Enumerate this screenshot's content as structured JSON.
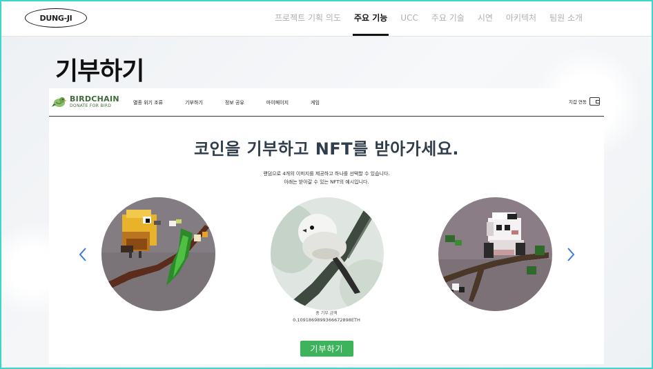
{
  "site": {
    "logo": "DUNG-JI",
    "nav": [
      "프로젝트 기획 의도",
      "주요 기능",
      "UCC",
      "주요 기술",
      "시연",
      "아키텍처",
      "팀원 소개"
    ],
    "active_index": 1
  },
  "page_title": "기부하기",
  "app": {
    "brand_name": "BIRDCHAIN",
    "brand_sub": "DONATE FOR BIRD",
    "nav": [
      "멸종 위기 조류",
      "기부하기",
      "정보 공유",
      "마이페이지",
      "게임"
    ],
    "wallet_label": "지갑 연동",
    "hero_title": "코인을 기부하고 NFT를 받아가세요.",
    "desc_line1": "랜덤으로 4개의 이미지를 제공하고 하나를 선택할 수 있습니다.",
    "desc_line2": "아래는 받아갈 수 있는 NFT의 예시입니다.",
    "total_label": "총 기부 금액",
    "total_value": "0.1091869899366672898ETH",
    "donate_button": "기부하기",
    "nft_images": [
      "pixel-yellow-bird",
      "long-tailed-tit-painting",
      "pixel-white-bird"
    ]
  },
  "colors": {
    "frame": "#3fd5cf",
    "brand_green": "#3f6b3a",
    "button_green": "#3db35c",
    "arrow_blue": "#3a7bd5",
    "title": "#2f3d4c"
  }
}
